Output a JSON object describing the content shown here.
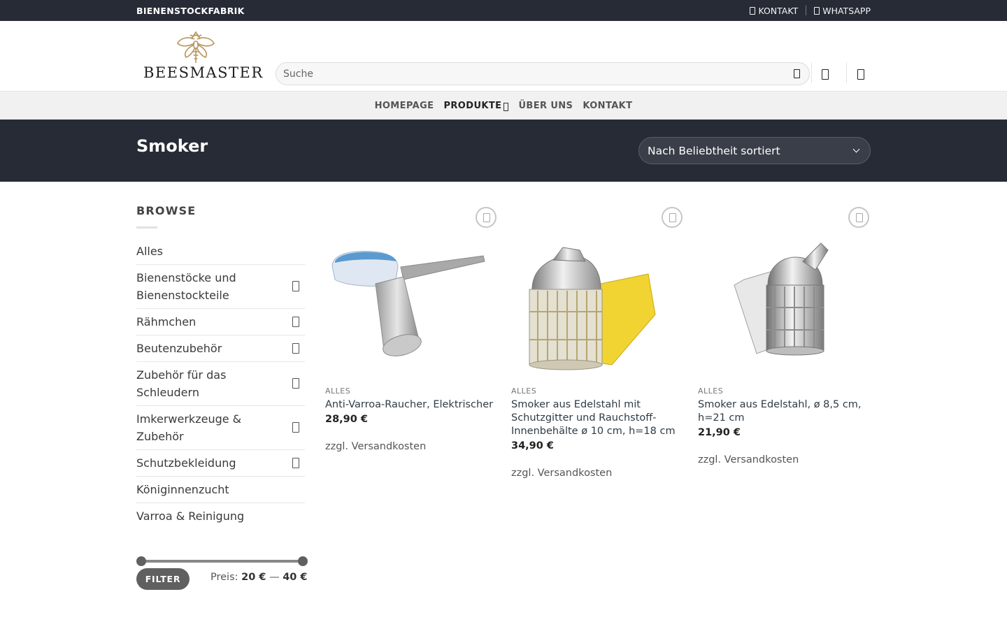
{
  "topbar": {
    "brand": "BIENENSTOCKFABRIK",
    "contact_label": "KONTAKT",
    "whatsapp_label": "WHATSAPP"
  },
  "header": {
    "logo_text": "BEESMASTER",
    "search_placeholder": "Suche"
  },
  "nav": {
    "items": [
      "HOMEPAGE",
      "PRODUKTE",
      "ÜBER UNS",
      "KONTAKT"
    ]
  },
  "titlebar": {
    "title": "Smoker",
    "sort_selected": "Nach Beliebtheit sortiert"
  },
  "sidebar": {
    "heading": "BROWSE",
    "categories": [
      {
        "label": "Alles",
        "has_children": false
      },
      {
        "label": "Bienenstöcke und Bienenstockteile",
        "has_children": true
      },
      {
        "label": "Rähmchen",
        "has_children": true
      },
      {
        "label": "Beutenzubehör",
        "has_children": true
      },
      {
        "label": "Zubehör für das Schleudern",
        "has_children": true
      },
      {
        "label": "Imkerwerkzeuge & Zubehör",
        "has_children": true
      },
      {
        "label": "Schutzbekleidung",
        "has_children": true
      },
      {
        "label": "Königinnenzucht",
        "has_children": false
      },
      {
        "label": "Varroa & Reinigung",
        "has_children": false
      }
    ],
    "filter_label": "FILTER",
    "price_prefix": "Preis:",
    "price_min": "20 €",
    "price_sep": "—",
    "price_max": "40 €"
  },
  "products": [
    {
      "category": "ALLES",
      "name": "Anti-Varroa-Raucher, Elektrischer",
      "price": "28,90 €",
      "shipping": "zzgl. Versandkosten"
    },
    {
      "category": "ALLES",
      "name": "Smoker aus Edelstahl mit Schutzgitter und Rauchstoff-Innenbehälte ø 10 cm, h=18 cm",
      "price": "34,90 €",
      "shipping": "zzgl. Versandkosten"
    },
    {
      "category": "ALLES",
      "name": "Smoker aus Edelstahl, ø 8,5 cm, h=21 cm",
      "price": "21,90 €",
      "shipping": "zzgl. Versandkosten"
    }
  ],
  "colors": {
    "dark_bar": "#272b36",
    "nav_bg": "#f1f1f1",
    "button": "#606060",
    "logo_gold": "#b8955a"
  }
}
